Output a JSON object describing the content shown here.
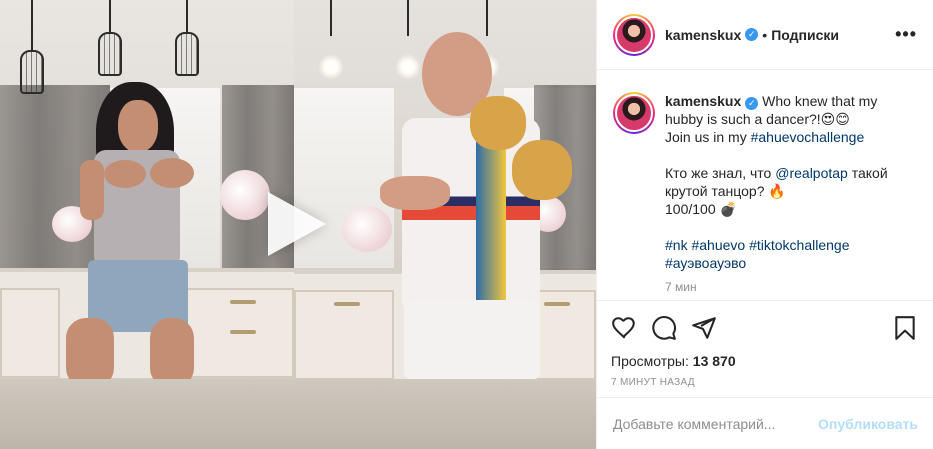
{
  "header": {
    "username": "kamenskux",
    "separator": "•",
    "follow_label": "Подписки",
    "more_label": "•••"
  },
  "caption": {
    "username": "kamenskux",
    "line1": "Who knew that my hubby is such a dancer?!😍😊",
    "line2_prefix": "Join us in my ",
    "line2_tag": "#ahuevochallenge",
    "ru1_prefix": "Кто же знал, что ",
    "ru1_mention": "@realpotap",
    "ru1_suffix": " такой крутой танцор? 🔥",
    "ru2": "100/100 💣",
    "tag_nk": "#nk",
    "tag_ahuevo": "#ahuevo",
    "tag_tiktok": "#tiktokchallenge",
    "tag_ru": "#ауэвоауэво",
    "time_short": "7 мин"
  },
  "stats": {
    "views_label": "Просмотры:",
    "views_count": "13 870",
    "posted": "7 минут назад"
  },
  "comment": {
    "placeholder": "Добавьте комментарий...",
    "publish_label": "Опубликовать"
  },
  "icons": {
    "like": "heart-icon",
    "comment": "comment-icon",
    "share": "share-icon",
    "save": "bookmark-icon",
    "play": "play-icon",
    "verified": "verified-icon"
  },
  "colors": {
    "link": "#00376b",
    "verified": "#3897f0",
    "publish": "#b2dffc"
  }
}
